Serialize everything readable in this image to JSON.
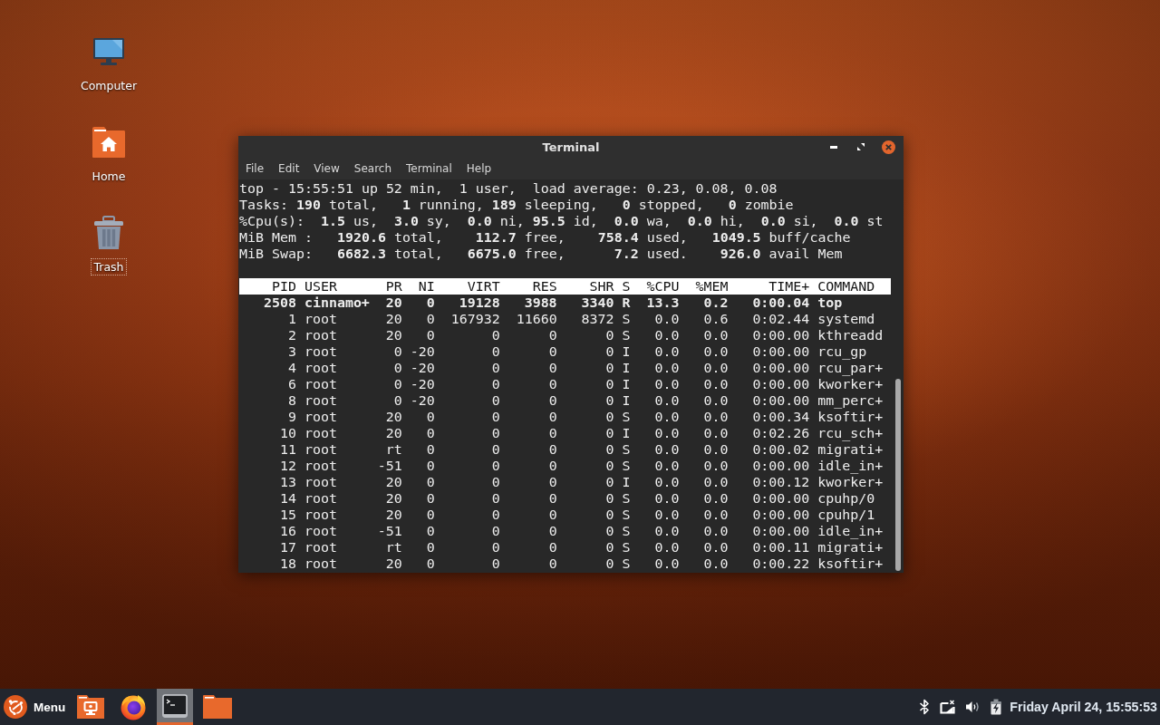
{
  "desktop_icons": [
    {
      "kind": "computer",
      "label": "Computer",
      "selected": false
    },
    {
      "kind": "home",
      "label": "Home",
      "selected": false
    },
    {
      "kind": "trash",
      "label": "Trash",
      "selected": true
    }
  ],
  "terminal": {
    "title": "Terminal",
    "menu": [
      "File",
      "Edit",
      "View",
      "Search",
      "Terminal",
      "Help"
    ],
    "summary": [
      "top - 15:55:51 up 52 min,  1 user,  load average: 0.23, 0.08, 0.08",
      "Tasks: **190** total,   **1** running, **189** sleeping,   **0** stopped,   **0** zombie",
      "%Cpu(s):  **1.5** us,  **3.0** sy,  **0.0** ni, **95.5** id,  **0.0** wa,  **0.0** hi,  **0.0** si,  **0.0** st",
      "MiB Mem :   **1920.6** total,    **112.7** free,    **758.4** used,   **1049.5** buff/cache",
      "MiB Swap:   **6682.3** total,   **6675.0** free,      **7.2** used.    **926.0** avail Mem"
    ],
    "table": {
      "columns": [
        "PID",
        "USER",
        "PR",
        "NI",
        "VIRT",
        "RES",
        "SHR",
        "S",
        "%CPU",
        "%MEM",
        "TIME+",
        "COMMAND"
      ],
      "rows": [
        {
          "highlighted": true,
          "cells": [
            "2508",
            "cinnamo+",
            "20",
            "0",
            "19128",
            "3988",
            "3340",
            "R",
            "13.3",
            "0.2",
            "0:00.04",
            "top"
          ]
        },
        {
          "highlighted": false,
          "cells": [
            "1",
            "root",
            "20",
            "0",
            "167932",
            "11660",
            "8372",
            "S",
            "0.0",
            "0.6",
            "0:02.44",
            "systemd"
          ]
        },
        {
          "highlighted": false,
          "cells": [
            "2",
            "root",
            "20",
            "0",
            "0",
            "0",
            "0",
            "S",
            "0.0",
            "0.0",
            "0:00.00",
            "kthreadd"
          ]
        },
        {
          "highlighted": false,
          "cells": [
            "3",
            "root",
            "0",
            "-20",
            "0",
            "0",
            "0",
            "I",
            "0.0",
            "0.0",
            "0:00.00",
            "rcu_gp"
          ]
        },
        {
          "highlighted": false,
          "cells": [
            "4",
            "root",
            "0",
            "-20",
            "0",
            "0",
            "0",
            "I",
            "0.0",
            "0.0",
            "0:00.00",
            "rcu_par+"
          ]
        },
        {
          "highlighted": false,
          "cells": [
            "6",
            "root",
            "0",
            "-20",
            "0",
            "0",
            "0",
            "I",
            "0.0",
            "0.0",
            "0:00.00",
            "kworker+"
          ]
        },
        {
          "highlighted": false,
          "cells": [
            "8",
            "root",
            "0",
            "-20",
            "0",
            "0",
            "0",
            "I",
            "0.0",
            "0.0",
            "0:00.00",
            "mm_perc+"
          ]
        },
        {
          "highlighted": false,
          "cells": [
            "9",
            "root",
            "20",
            "0",
            "0",
            "0",
            "0",
            "S",
            "0.0",
            "0.0",
            "0:00.34",
            "ksoftir+"
          ]
        },
        {
          "highlighted": false,
          "cells": [
            "10",
            "root",
            "20",
            "0",
            "0",
            "0",
            "0",
            "I",
            "0.0",
            "0.0",
            "0:02.26",
            "rcu_sch+"
          ]
        },
        {
          "highlighted": false,
          "cells": [
            "11",
            "root",
            "rt",
            "0",
            "0",
            "0",
            "0",
            "S",
            "0.0",
            "0.0",
            "0:00.02",
            "migrati+"
          ]
        },
        {
          "highlighted": false,
          "cells": [
            "12",
            "root",
            "-51",
            "0",
            "0",
            "0",
            "0",
            "S",
            "0.0",
            "0.0",
            "0:00.00",
            "idle_in+"
          ]
        },
        {
          "highlighted": false,
          "cells": [
            "13",
            "root",
            "20",
            "0",
            "0",
            "0",
            "0",
            "I",
            "0.0",
            "0.0",
            "0:00.12",
            "kworker+"
          ]
        },
        {
          "highlighted": false,
          "cells": [
            "14",
            "root",
            "20",
            "0",
            "0",
            "0",
            "0",
            "S",
            "0.0",
            "0.0",
            "0:00.00",
            "cpuhp/0"
          ]
        },
        {
          "highlighted": false,
          "cells": [
            "15",
            "root",
            "20",
            "0",
            "0",
            "0",
            "0",
            "S",
            "0.0",
            "0.0",
            "0:00.00",
            "cpuhp/1"
          ]
        },
        {
          "highlighted": false,
          "cells": [
            "16",
            "root",
            "-51",
            "0",
            "0",
            "0",
            "0",
            "S",
            "0.0",
            "0.0",
            "0:00.00",
            "idle_in+"
          ]
        },
        {
          "highlighted": false,
          "cells": [
            "17",
            "root",
            "rt",
            "0",
            "0",
            "0",
            "0",
            "S",
            "0.0",
            "0.0",
            "0:00.11",
            "migrati+"
          ]
        },
        {
          "highlighted": false,
          "cells": [
            "18",
            "root",
            "20",
            "0",
            "0",
            "0",
            "0",
            "S",
            "0.0",
            "0.0",
            "0:00.22",
            "ksoftir+"
          ]
        }
      ]
    }
  },
  "taskbar": {
    "menu_label": "Menu",
    "launchers": [
      {
        "kind": "show-desktop",
        "active": false
      },
      {
        "kind": "browser",
        "active": false
      },
      {
        "kind": "terminal",
        "active": true
      },
      {
        "kind": "files",
        "active": false
      }
    ],
    "clock": "Friday April 24, 15:55:53"
  }
}
